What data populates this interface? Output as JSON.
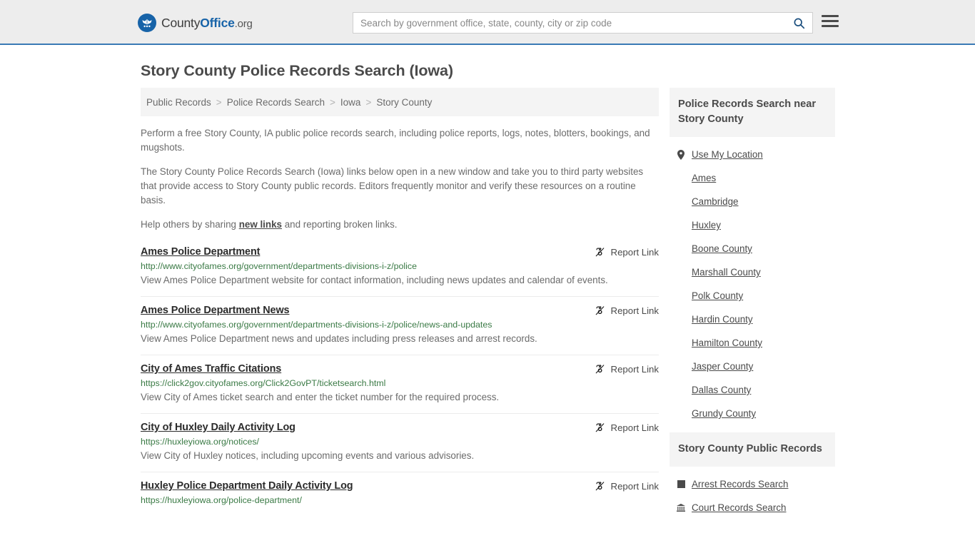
{
  "header": {
    "brand": {
      "part1": "County",
      "part2": "Office",
      "part3": ".org",
      "logo_icon": "eagle-seal-icon"
    },
    "search": {
      "placeholder": "Search by government office, state, county, city or zip code",
      "value": "",
      "icon": "search-icon"
    },
    "menu_icon": "hamburger-menu-icon",
    "accent_color": "#3a7ab5"
  },
  "page": {
    "title": "Story County Police Records Search (Iowa)"
  },
  "breadcrumb": {
    "items": [
      {
        "label": "Public Records",
        "current": false
      },
      {
        "label": "Police Records Search",
        "current": false
      },
      {
        "label": "Iowa",
        "current": false
      },
      {
        "label": "Story County",
        "current": true
      }
    ],
    "separator": ">"
  },
  "intro": {
    "paragraph1": "Perform a free Story County, IA public police records search, including police reports, logs, notes, blotters, bookings, and mugshots.",
    "paragraph2": "The Story County Police Records Search (Iowa) links below open in a new window and take you to third party websites that provide access to Story County public records. Editors frequently monitor and verify these resources on a routine basis.",
    "paragraph3_before": "Help others by sharing ",
    "paragraph3_link": "new links",
    "paragraph3_after": " and reporting broken links."
  },
  "results": {
    "report_label": "Report Link",
    "report_icon": "broken-link-icon",
    "items": [
      {
        "title": "Ames Police Department",
        "url": "http://www.cityofames.org/government/departments-divisions-i-z/police",
        "description": "View Ames Police Department website for contact information, including news updates and calendar of events."
      },
      {
        "title": "Ames Police Department News",
        "url": "http://www.cityofames.org/government/departments-divisions-i-z/police/news-and-updates",
        "description": "View Ames Police Department news and updates including press releases and arrest records."
      },
      {
        "title": "City of Ames Traffic Citations",
        "url": "https://click2gov.cityofames.org/Click2GovPT/ticketsearch.html",
        "description": "View City of Ames ticket search and enter the ticket number for the required process."
      },
      {
        "title": "City of Huxley Daily Activity Log",
        "url": "https://huxleyiowa.org/notices/",
        "description": "View City of Huxley notices, including upcoming events and various advisories."
      },
      {
        "title": "Huxley Police Department Daily Activity Log",
        "url": "https://huxleyiowa.org/police-department/",
        "description": ""
      }
    ]
  },
  "sidebar": {
    "nearby": {
      "heading": "Police Records Search near Story County",
      "items": [
        {
          "label": "Use My Location",
          "icon": "map-pin-icon"
        },
        {
          "label": "Ames",
          "icon": ""
        },
        {
          "label": "Cambridge",
          "icon": ""
        },
        {
          "label": "Huxley",
          "icon": ""
        },
        {
          "label": "Boone County",
          "icon": ""
        },
        {
          "label": "Marshall County",
          "icon": ""
        },
        {
          "label": "Polk County",
          "icon": ""
        },
        {
          "label": "Hardin County",
          "icon": ""
        },
        {
          "label": "Hamilton County",
          "icon": ""
        },
        {
          "label": "Jasper County",
          "icon": ""
        },
        {
          "label": "Dallas County",
          "icon": ""
        },
        {
          "label": "Grundy County",
          "icon": ""
        }
      ]
    },
    "public_records": {
      "heading": "Story County Public Records",
      "items": [
        {
          "label": "Arrest Records Search",
          "icon": "arrest-records-icon"
        },
        {
          "label": "Court Records Search",
          "icon": "courthouse-icon"
        }
      ]
    }
  }
}
